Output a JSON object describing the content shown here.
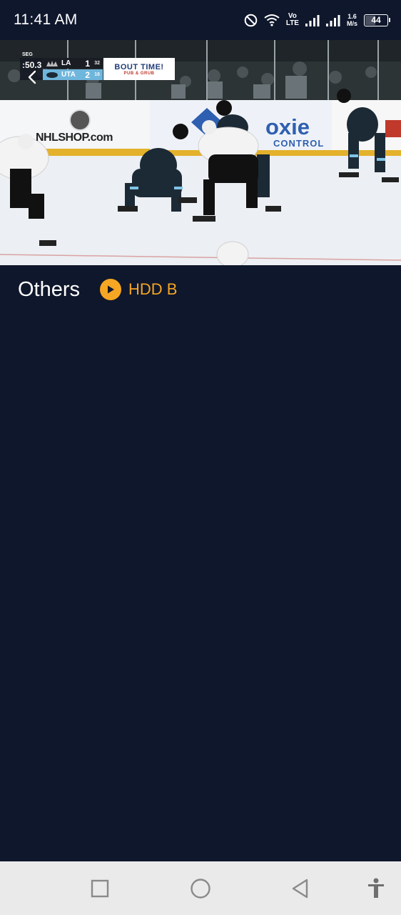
{
  "status_bar": {
    "time": "11:41 AM",
    "network_top": "Vo",
    "network_bottom": "LTE",
    "speed_value": "1.6",
    "speed_unit": "M/s",
    "battery_level": "44",
    "icons": [
      "do-not-disturb-icon",
      "wifi-icon",
      "signal-icon",
      "signal-icon",
      "battery-icon"
    ]
  },
  "video": {
    "scorebug": {
      "period": "SEG",
      "clock": ":50.3",
      "away_team": "LA",
      "away_score": "1",
      "away_sog": "32",
      "home_team": "UTA",
      "home_score": "2",
      "home_sog": "16"
    },
    "sponsor": {
      "line1": "BOUT TIME!",
      "line2": "PUB & GRUB"
    },
    "boards": {
      "nhl_shop": "NHLSHOP.com",
      "ad_main": "oxie",
      "ad_sub": "CONTROL"
    }
  },
  "content": {
    "category_label": "Others",
    "source_label": "HDD B"
  },
  "colors": {
    "background": "#0f172c",
    "accent": "#f5a623",
    "nav_bar": "#eaeaea"
  },
  "nav_bar": {
    "icons": [
      "recents-square-icon",
      "home-circle-icon",
      "back-triangle-icon",
      "accessibility-icon"
    ]
  }
}
